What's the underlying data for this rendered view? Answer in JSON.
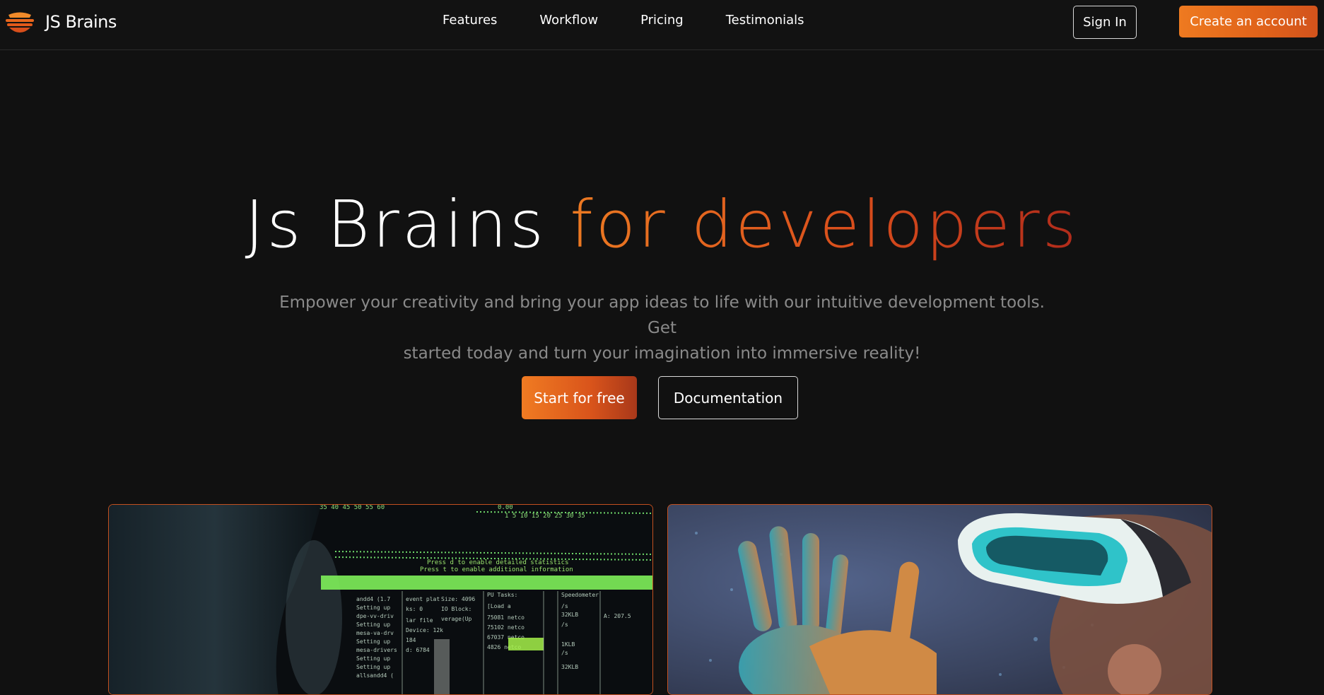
{
  "brand": {
    "name": "JS Brains",
    "logo_icon": "stacked-layers-logo-icon",
    "accent": "#e8671d"
  },
  "nav": {
    "links": [
      "Features",
      "Workflow",
      "Pricing",
      "Testimonials"
    ],
    "sign_in_label": "Sign In",
    "create_account_label": "Create an account"
  },
  "hero": {
    "title_plain": "Js Brains",
    "title_accent": "for developers",
    "subtitle_line1": "Empower your creativity and bring your app ideas to life with our intuitive development tools. Get",
    "subtitle_line2": "started today and turn your imagination into immersive reality!",
    "primary_cta": "Start for free",
    "secondary_cta": "Documentation"
  },
  "images": {
    "left": "terminal-code-monitor-photo",
    "right": "vr-headset-person-photo"
  }
}
